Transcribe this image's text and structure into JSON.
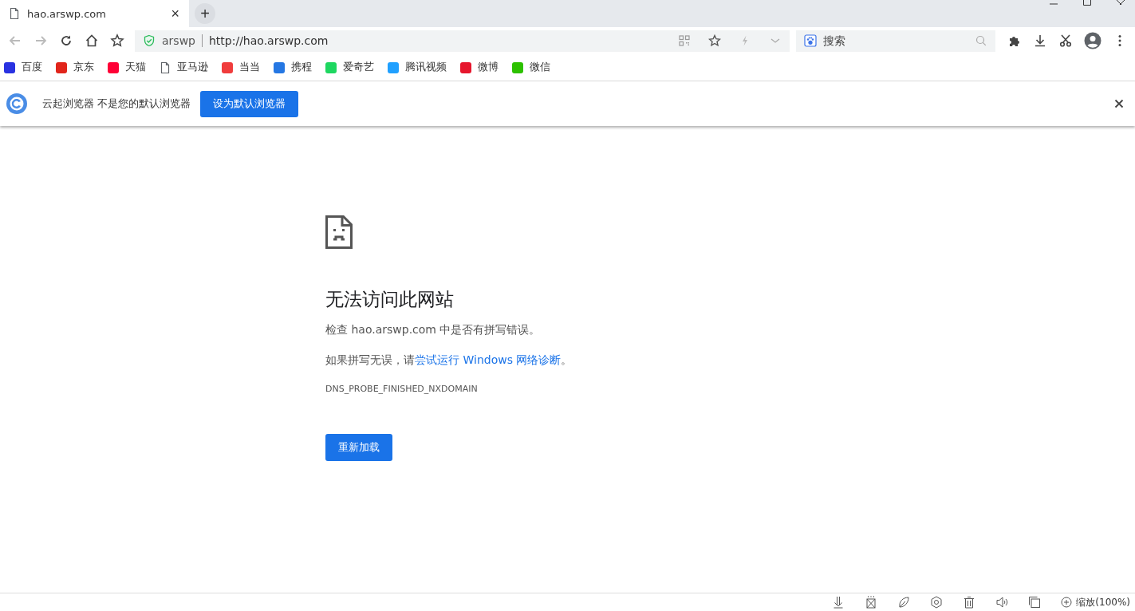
{
  "tab": {
    "title": "hao.arswp.com",
    "close": "×",
    "new_tab": "+"
  },
  "toolbar": {
    "site_name": "arswp",
    "url": "http://hao.arswp.com",
    "search": {
      "placeholder": "搜索"
    }
  },
  "bookmarks": [
    {
      "label": "百度",
      "kind": "site",
      "color": "#2932e1"
    },
    {
      "label": "京东",
      "kind": "site",
      "color": "#e1251b"
    },
    {
      "label": "天猫",
      "kind": "site",
      "color": "#ff0036"
    },
    {
      "label": "亚马逊",
      "kind": "page"
    },
    {
      "label": "当当",
      "kind": "site",
      "color": "#f03c3c"
    },
    {
      "label": "携程",
      "kind": "site",
      "color": "#2577e3"
    },
    {
      "label": "爱奇艺",
      "kind": "site",
      "color": "#1ed760"
    },
    {
      "label": "腾讯视频",
      "kind": "site",
      "color": "#20a0ff"
    },
    {
      "label": "微博",
      "kind": "site",
      "color": "#e6162d"
    },
    {
      "label": "微信",
      "kind": "site",
      "color": "#2dc100"
    }
  ],
  "infobar": {
    "message": "云起浏览器 不是您的默认浏览器",
    "button": "设为默认浏览器"
  },
  "error": {
    "title": "无法访问此网站",
    "check": "检查 hao.arswp.com 中是否有拼写错误。",
    "suggest_before": "如果拼写无误，请",
    "suggest_link": "尝试运行 Windows 网络诊断",
    "suggest_after": "。",
    "code": "DNS_PROBE_FINISHED_NXDOMAIN",
    "reload": "重新加载"
  },
  "status_bar": {
    "zoom": "缩放(100%)"
  }
}
